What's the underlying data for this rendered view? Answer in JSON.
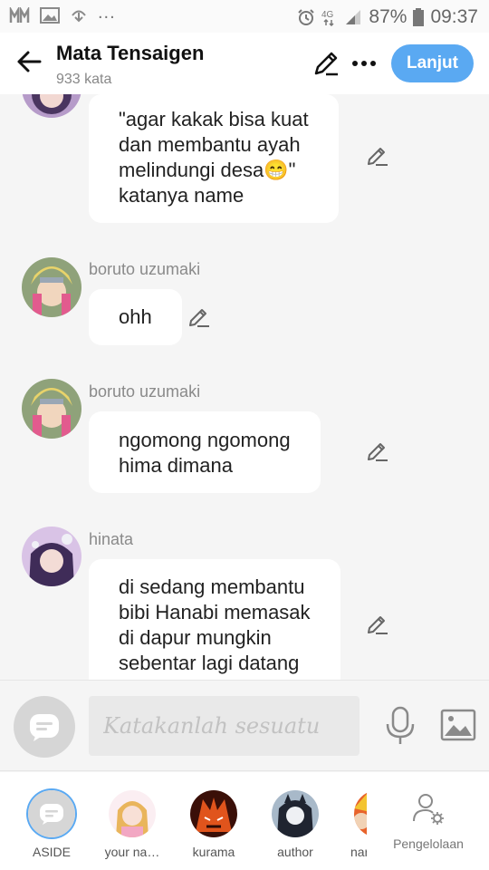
{
  "status_bar": {
    "icons": [
      "signal-app-icon",
      "gallery-icon",
      "download-icon"
    ],
    "dots": "...",
    "battery": "87%",
    "time": "09:37"
  },
  "header": {
    "title": "Mata Tensaigen",
    "word_count": "933 kata",
    "next_label": "Lanjut"
  },
  "messages": [
    {
      "sender": "",
      "lines": [
        "\"agar kakak bisa kuat",
        "dan membantu ayah",
        "melindungi desa😁\"",
        "katanya name"
      ]
    },
    {
      "sender": "boruto uzumaki",
      "lines": [
        "ohh"
      ]
    },
    {
      "sender": "boruto uzumaki",
      "lines": [
        "ngomong ngomong",
        "hima dimana"
      ]
    },
    {
      "sender": "hinata",
      "lines": [
        "di sedang membantu",
        "bibi Hanabi memasak",
        "di dapur mungkin",
        "sebentar lagi datang"
      ]
    }
  ],
  "composer": {
    "placeholder": "Katakanlah sesuatu"
  },
  "characters": [
    {
      "name": "ASIDE",
      "active": true
    },
    {
      "name": "your na…"
    },
    {
      "name": "kurama"
    },
    {
      "name": "author"
    },
    {
      "name": "nar"
    }
  ],
  "manage_label": "Pengelolaan",
  "colors": {
    "accent": "#5aa9f2",
    "bubble": "#ffffff",
    "background": "#f5f5f5"
  }
}
